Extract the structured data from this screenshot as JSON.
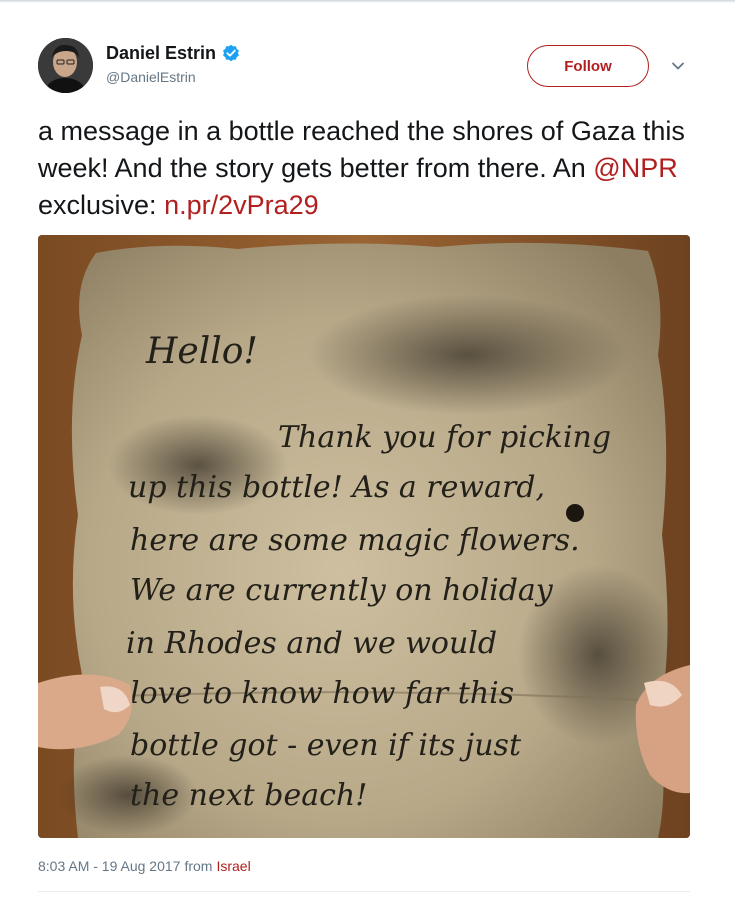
{
  "author": {
    "display_name": "Daniel Estrin",
    "handle": "@DanielEstrin",
    "verified": true,
    "avatar_icon": "person-avatar"
  },
  "actions": {
    "follow_label": "Follow",
    "menu_icon": "chevron-down-icon"
  },
  "tweet": {
    "text_part1": "a message in a bottle reached the shores of Gaza this week! And the story gets better from there. An ",
    "mention": "@NPR",
    "text_part2": " exclusive: ",
    "link": "n.pr/2vPra29"
  },
  "media": {
    "letter_lines": [
      "Hello!",
      "Thank you for picking",
      "up this bottle! As a reward,",
      "here are some magic flowers.",
      "We are currently on holiday",
      "in Rhodes and we would",
      "love to know how far this",
      "bottle got - even if its just",
      "the next beach!"
    ]
  },
  "meta": {
    "timestamp": "8:03 AM - 19 Aug 2017",
    "from_label": "from",
    "place": "Israel"
  },
  "colors": {
    "accent": "#b21f1f",
    "muted": "#657786",
    "verified": "#1da1f2"
  }
}
